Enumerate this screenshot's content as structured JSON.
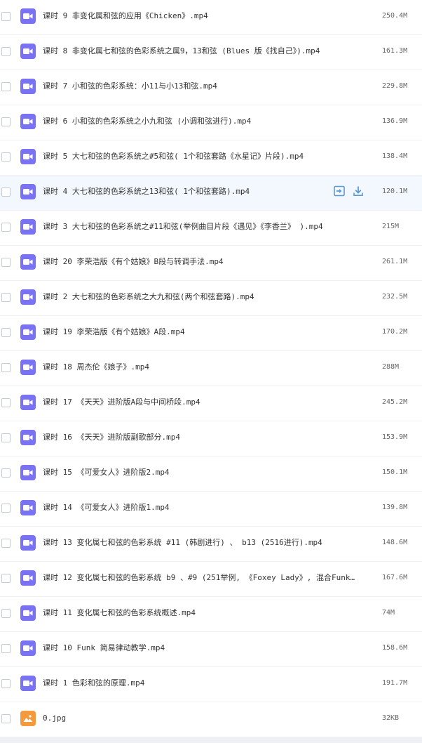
{
  "colors": {
    "video_icon": "#7a72f5",
    "image_icon": "#f59a3c",
    "hover_row": "#f3f8fe",
    "action_icon": "#5b9bd5"
  },
  "actions": {
    "share_icon": "share-icon",
    "download_icon": "download-icon"
  },
  "files": [
    {
      "name": "课时 9 非变化属和弦的应用《Chicken》.mp4",
      "size": "250.4M",
      "type": "video"
    },
    {
      "name": "课时 8 非变化属七和弦的色彩系统之属9，13和弦 (Blues 版《找自己》).mp4",
      "size": "161.3M",
      "type": "video"
    },
    {
      "name": "课时 7 小和弦的色彩系统：小11与小13和弦.mp4",
      "size": "229.8M",
      "type": "video"
    },
    {
      "name": "课时 6 小和弦的色彩系统之小九和弦 (小调和弦进行).mp4",
      "size": "136.9M",
      "type": "video"
    },
    {
      "name": "课时 5 大七和弦的色彩系统之#5和弦( 1个和弦套路《水星记》片段).mp4",
      "size": "138.4M",
      "type": "video"
    },
    {
      "name": "课时 4 大七和弦的色彩系统之13和弦( 1个和弦套路).mp4",
      "size": "120.1M",
      "type": "video",
      "hovered": true
    },
    {
      "name": "课时 3 大七和弦的色彩系统之#11和弦(举例曲目片段《遇见》《李香兰》 ).mp4",
      "size": "215M",
      "type": "video"
    },
    {
      "name": "课时 20 李荣浩版《有个姑娘》B段与转调手法.mp4",
      "size": "261.1M",
      "type": "video"
    },
    {
      "name": "课时 2 大七和弦的色彩系统之大九和弦(两个和弦套路).mp4",
      "size": "232.5M",
      "type": "video"
    },
    {
      "name": "课时 19 李荣浩版《有个姑娘》A段.mp4",
      "size": "170.2M",
      "type": "video"
    },
    {
      "name": "课时 18 周杰伦《娘子》.mp4",
      "size": "288M",
      "type": "video"
    },
    {
      "name": "课时 17 《天天》进阶版A段与中间桥段.mp4",
      "size": "245.2M",
      "type": "video"
    },
    {
      "name": "课时 16 《天天》进阶版副歌部分.mp4",
      "size": "153.9M",
      "type": "video"
    },
    {
      "name": "课时 15 《可爱女人》进阶版2.mp4",
      "size": "150.1M",
      "type": "video"
    },
    {
      "name": "课时 14 《可爱女人》进阶版1.mp4",
      "size": "139.8M",
      "type": "video"
    },
    {
      "name": "课时 13 变化属七和弦的色彩系统 #11 (韩剧进行) 、 b13 (2516进行).mp4",
      "size": "148.6M",
      "type": "video"
    },
    {
      "name": "课时 12 变化属七和弦的色彩系统 b9 、#9 (251举例, 《Foxey Lady》, 混合Funk…",
      "size": "167.6M",
      "type": "video"
    },
    {
      "name": "课时 11 变化属七和弦的色彩系统概述.mp4",
      "size": "74M",
      "type": "video"
    },
    {
      "name": "课时 10 Funk 简易律动教学.mp4",
      "size": "158.6M",
      "type": "video"
    },
    {
      "name": "课时 1 色彩和弦的原理.mp4",
      "size": "191.7M",
      "type": "video"
    },
    {
      "name": "0.jpg",
      "size": "32KB",
      "type": "image"
    }
  ]
}
